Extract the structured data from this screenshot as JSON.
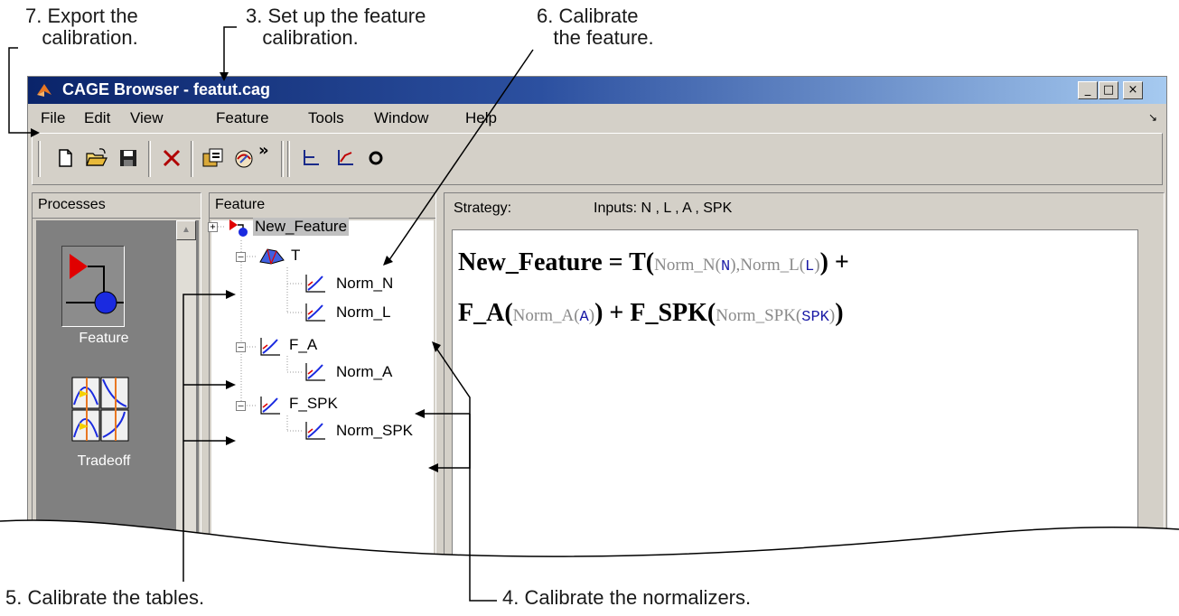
{
  "callouts": {
    "export": "7. Export the\n   calibration.",
    "setup": "3. Set up the feature\n   calibration.",
    "calibrate_feature": "6. Calibrate\n   the feature.",
    "tables": "5. Calibrate the tables.",
    "normalizers": "4. Calibrate the normalizers."
  },
  "window": {
    "title": "CAGE Browser - featut.cag",
    "controls": {
      "minimize": "_",
      "maximize": "□",
      "close": "×"
    }
  },
  "menu": [
    "File",
    "Edit",
    "View",
    "Feature",
    "Tools",
    "Window",
    "Help"
  ],
  "toolbar": {
    "buttons": [
      "new-icon",
      "open-icon",
      "save-icon",
      "delete-icon",
      "import-icon",
      "export-icon",
      "more-icon",
      "table-icon",
      "normalizer-icon",
      "feature-icon"
    ],
    "overflow": "»"
  },
  "processes": {
    "header": "Processes",
    "items": [
      {
        "label": "Feature",
        "icon": "feature-process-icon"
      },
      {
        "label": "Tradeoff",
        "icon": "tradeoff-process-icon"
      }
    ]
  },
  "feature_tree": {
    "header": "Feature",
    "items": [
      {
        "label": "New_Feature",
        "level": 0,
        "icon": "feature-icon",
        "selected": true
      },
      {
        "label": "T",
        "level": 1,
        "icon": "table-icon",
        "expanded": true
      },
      {
        "label": "Norm_N",
        "level": 2,
        "icon": "normalizer-icon"
      },
      {
        "label": "Norm_L",
        "level": 2,
        "icon": "normalizer-icon"
      },
      {
        "label": "F_A",
        "level": 1,
        "icon": "function-icon",
        "expanded": true
      },
      {
        "label": "Norm_A",
        "level": 2,
        "icon": "normalizer-icon"
      },
      {
        "label": "F_SPK",
        "level": 1,
        "icon": "function-icon",
        "expanded": true
      },
      {
        "label": "Norm_SPK",
        "level": 2,
        "icon": "normalizer-icon"
      }
    ]
  },
  "strategy": {
    "label": "Strategy:",
    "inputs": "Inputs: N , L , A , SPK",
    "equation": {
      "line1": {
        "lhs": "New_Feature = T(",
        "g1": "Norm_N(",
        "v1": "N",
        "g2": "),Norm_L(",
        "v2": "L",
        "g3": ")",
        "tail": ") +"
      },
      "line2": {
        "p1": "F_A(",
        "g1": "Norm_A(",
        "v1": "A",
        "g2": ")",
        "p2": ") + F_SPK(",
        "g3": "Norm_SPK(",
        "v2": "SPK",
        "g4": ")",
        "tail": ")"
      }
    }
  },
  "colors": {
    "titlebar_start": "#0a246a",
    "titlebar_end": "#a6caf0",
    "chrome": "#d4d0c8",
    "equation_variable": "#1a1aa6",
    "equation_gray": "#8a8a8a"
  }
}
